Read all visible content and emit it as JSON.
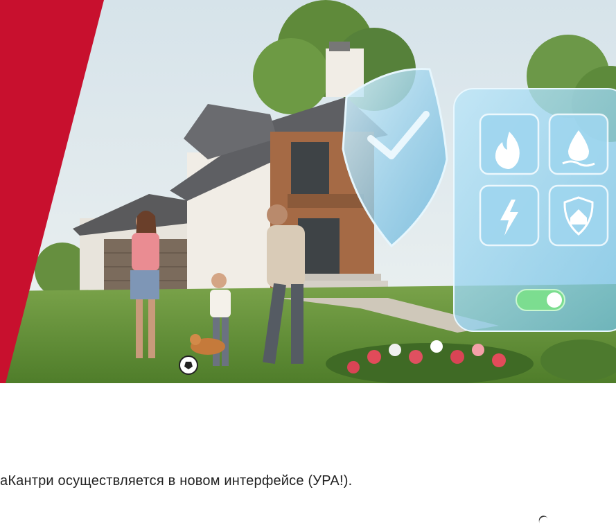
{
  "caption": "аКантри осуществляется в новом интерфейсе (УРА!).",
  "hero": {
    "icons": [
      "fire-icon",
      "water-drop-icon",
      "lightning-icon",
      "home-shield-icon",
      "toggle-switch-icon",
      "checkmark-shield-icon"
    ],
    "toggle_state": "on"
  },
  "colors": {
    "accent_red": "#c8102e",
    "toggle_green": "#7be08a",
    "panel_blue": "#8fd2ef"
  }
}
